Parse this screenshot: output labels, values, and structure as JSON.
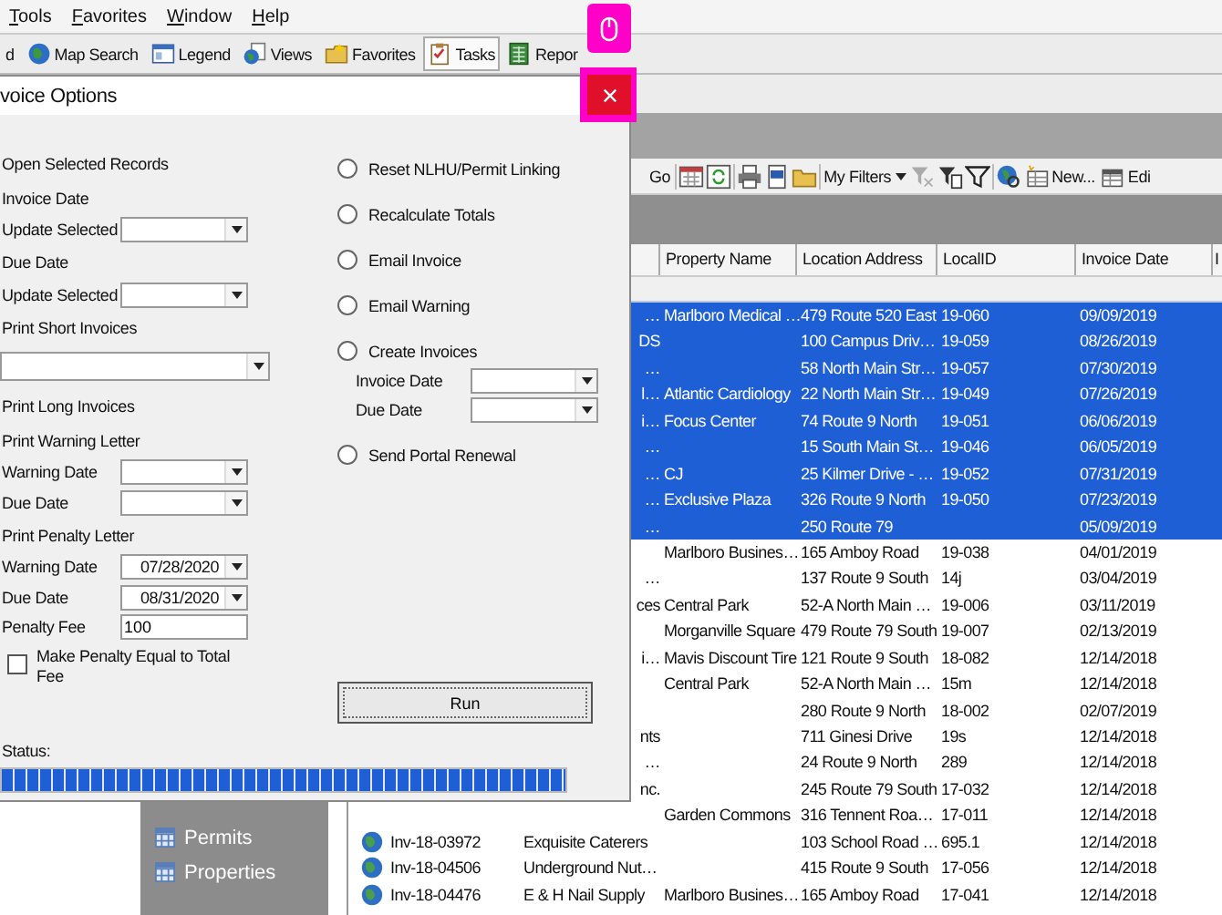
{
  "menu": [
    "Tools",
    "Favorites",
    "Window",
    "Help"
  ],
  "toolbar": [
    {
      "label": "d",
      "selected": false
    },
    {
      "label": "Map Search",
      "selected": false
    },
    {
      "label": "Legend",
      "selected": false
    },
    {
      "label": "Views",
      "selected": false
    },
    {
      "label": "Favorites",
      "selected": false
    },
    {
      "label": "Tasks",
      "selected": true
    },
    {
      "label": "Repor",
      "selected": false
    }
  ],
  "grid_toolbar": {
    "go": "Go",
    "filters": "My Filters",
    "new": "New...",
    "edit": "Edi"
  },
  "table": {
    "columns": [
      "Property Name",
      "Location Address",
      "LocalID",
      "Invoice Date",
      "I"
    ],
    "rows": [
      {
        "selected": true,
        "name_tail": "…",
        "property": "Marlboro Medical …",
        "address": "479 Route 520 East",
        "local_id": "19-060",
        "date": "09/09/2019"
      },
      {
        "selected": true,
        "name_tail": "DS",
        "address": "100 Campus Driv…",
        "local_id": "19-059",
        "date": "08/26/2019"
      },
      {
        "selected": true,
        "name_tail": "…",
        "address": "58 North Main Str…",
        "local_id": "19-057",
        "date": "07/30/2019"
      },
      {
        "selected": true,
        "name_tail": "l…",
        "property": "Atlantic Cardiology",
        "address": "22 North Main Str…",
        "local_id": "19-049",
        "date": "07/26/2019"
      },
      {
        "selected": true,
        "name_tail": "i…",
        "property": "Focus Center",
        "address": "74 Route 9 North",
        "local_id": "19-051",
        "date": "06/06/2019"
      },
      {
        "selected": true,
        "name_tail": "…",
        "address": "15 South Main St…",
        "local_id": "19-046",
        "date": "06/05/2019"
      },
      {
        "selected": true,
        "name_tail": "…",
        "property": "CJ",
        "address": "25 Kilmer Drive - …",
        "local_id": "19-052",
        "date": "07/31/2019"
      },
      {
        "selected": true,
        "name_tail": "…",
        "property": "Exclusive Plaza",
        "address": "326 Route 9 North",
        "local_id": "19-050",
        "date": "07/23/2019"
      },
      {
        "selected": true,
        "name_tail": "…",
        "address": "250 Route 79",
        "date": "05/09/2019"
      },
      {
        "selected": false,
        "property": "Marlboro Busines…",
        "address": "165 Amboy Road",
        "local_id": "19-038",
        "date": "04/01/2019"
      },
      {
        "selected": false,
        "name_tail": "…",
        "address": "137 Route 9 South",
        "local_id": "14j",
        "date": "03/04/2019"
      },
      {
        "selected": false,
        "name_tail": "ces",
        "property": "Central Park",
        "address": "52-A North Main …",
        "local_id": "19-006",
        "date": "03/11/2019"
      },
      {
        "selected": false,
        "property": "Morganville Square",
        "address": "479 Route 79 South",
        "local_id": "19-007",
        "date": "02/13/2019"
      },
      {
        "selected": false,
        "name_tail": "i…",
        "property": "Mavis Discount Tire",
        "address": "121 Route 9 South",
        "local_id": "18-082",
        "date": "12/14/2018"
      },
      {
        "selected": false,
        "property": "Central Park",
        "address": "52-A North Main …",
        "local_id": "15m",
        "date": "12/14/2018"
      },
      {
        "selected": false,
        "address": "280 Route 9 North",
        "local_id": "18-002",
        "date": "02/07/2019"
      },
      {
        "selected": false,
        "name_tail": "nts",
        "address": "711 Ginesi Drive",
        "local_id": "19s",
        "date": "12/14/2018"
      },
      {
        "selected": false,
        "name_tail": "…",
        "address": "24 Route 9 North",
        "local_id": "289",
        "date": "12/14/2018"
      },
      {
        "selected": false,
        "name_tail": "nc.",
        "address": "245 Route 79 South",
        "local_id": "17-032",
        "date": "12/14/2018"
      },
      {
        "selected": false,
        "property": "Garden Commons",
        "address": "316 Tennent Roa…",
        "local_id": "17-011",
        "date": "12/14/2018"
      },
      {
        "selected": false,
        "invoice": "Inv-18-03972",
        "name": "Exquisite Caterers",
        "address": "103 School Road …",
        "local_id": "695.1",
        "date": "12/14/2018"
      },
      {
        "selected": false,
        "invoice": "Inv-18-04506",
        "name": "Underground Nut…",
        "address": "415 Route 9 South",
        "local_id": "17-056",
        "date": "12/14/2018"
      },
      {
        "selected": false,
        "invoice": "Inv-18-04476",
        "name": "E & H Nail Supply",
        "property": "Marlboro Busines…",
        "address": "165 Amboy Road",
        "local_id": "17-041",
        "date": "12/14/2018"
      }
    ]
  },
  "sidebar": {
    "items": [
      "Permits",
      "Properties"
    ]
  },
  "dialog": {
    "title": "voice Options",
    "left": [
      {
        "kind": "heading",
        "label": "Open Selected Records"
      },
      {
        "kind": "heading",
        "label": "Invoice Date"
      },
      {
        "kind": "dropdown",
        "label": "Update Selected"
      },
      {
        "kind": "heading",
        "label": "Due Date"
      },
      {
        "kind": "dropdown",
        "label": "Update Selected"
      },
      {
        "kind": "heading",
        "label": "Print Short Invoices"
      },
      {
        "kind": "wide_dropdown"
      },
      {
        "kind": "heading",
        "label": "Print Long Invoices"
      },
      {
        "kind": "heading",
        "label": "Print Warning Letter"
      },
      {
        "kind": "dropdown",
        "label": "Warning Date"
      },
      {
        "kind": "dropdown",
        "label": "Due Date"
      },
      {
        "kind": "heading",
        "label": "Print Penalty Letter"
      },
      {
        "kind": "dropdown",
        "label": "Warning Date",
        "value": "07/28/2020"
      },
      {
        "kind": "dropdown",
        "label": "Due Date",
        "value": "08/31/2020"
      },
      {
        "kind": "input",
        "label": "Penalty Fee",
        "value": "100"
      },
      {
        "kind": "checkbox",
        "label": "Make Penalty Equal to Total Fee",
        "checked": false
      }
    ],
    "right": [
      {
        "kind": "radio",
        "label": "Reset NLHU/Permit Linking",
        "selected": false
      },
      {
        "kind": "radio",
        "label": "Recalculate Totals",
        "selected": false
      },
      {
        "kind": "radio",
        "label": "Email Invoice",
        "selected": false
      },
      {
        "kind": "radio",
        "label": "Email Warning",
        "selected": false
      },
      {
        "kind": "radio",
        "label": "Create Invoices",
        "selected": false
      },
      {
        "kind": "dropdown",
        "label": "Invoice Date"
      },
      {
        "kind": "dropdown",
        "label": "Due Date"
      },
      {
        "kind": "radio",
        "label": "Send Portal Renewal",
        "selected": false
      }
    ],
    "run_button": "Run",
    "status_label": "Status:",
    "progress": {
      "level": 1
    }
  }
}
